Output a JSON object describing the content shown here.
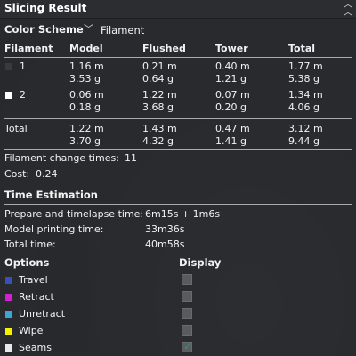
{
  "panel": {
    "title": "Slicing Result",
    "collapse_icon": "double-chevron-up-icon"
  },
  "color_scheme": {
    "label": "Color Scheme",
    "dropdown_icon": "chevron-down-icon",
    "selected": "Filament"
  },
  "filament_table": {
    "headers": [
      "Filament",
      "Model",
      "Flushed",
      "Tower",
      "Total"
    ],
    "rows": [
      {
        "id": "1",
        "swatch_color": "#3a3a3a",
        "model": [
          "1.16 m",
          "3.53 g"
        ],
        "flushed": [
          "0.21 m",
          "0.64 g"
        ],
        "tower": [
          "0.40 m",
          "1.21 g"
        ],
        "total": [
          "1.77 m",
          "5.38 g"
        ]
      },
      {
        "id": "2",
        "swatch_color": "#ffffff",
        "model": [
          "0.06 m",
          "0.18 g"
        ],
        "flushed": [
          "1.22 m",
          "3.68 g"
        ],
        "tower": [
          "0.07 m",
          "0.20 g"
        ],
        "total": [
          "1.34 m",
          "4.06 g"
        ]
      }
    ],
    "total_row": {
      "label": "Total",
      "model": [
        "1.22 m",
        "3.70 g"
      ],
      "flushed": [
        "1.43 m",
        "4.32 g"
      ],
      "tower": [
        "0.47 m",
        "1.41 g"
      ],
      "total": [
        "3.12 m",
        "9.44 g"
      ]
    }
  },
  "filament_change": {
    "label": "Filament change times:",
    "value": "11"
  },
  "cost": {
    "label": "Cost:",
    "value": "0.24"
  },
  "time_estimation": {
    "heading": "Time Estimation",
    "rows": [
      {
        "label": "Prepare and timelapse time:",
        "value": "6m15s + 1m6s"
      },
      {
        "label": "Model printing time:",
        "value": "33m36s"
      },
      {
        "label": "Total time:",
        "value": "40m58s"
      }
    ]
  },
  "options": {
    "header_options": "Options",
    "header_display": "Display",
    "items": [
      {
        "label": "Travel",
        "color": "#3b4fb8",
        "checked": false
      },
      {
        "label": "Retract",
        "color": "#d21fd2",
        "checked": false
      },
      {
        "label": "Unretract",
        "color": "#3aa6d8",
        "checked": false
      },
      {
        "label": "Wipe",
        "color": "#f2f200",
        "checked": false
      },
      {
        "label": "Seams",
        "color": "#e8e8e8",
        "checked": true
      }
    ],
    "check_icon": "checkmark-icon"
  }
}
